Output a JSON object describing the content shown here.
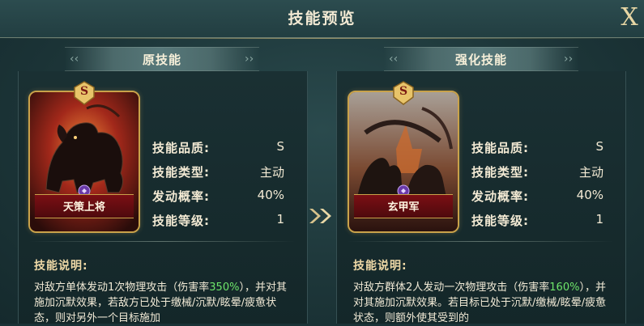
{
  "header": {
    "title": "技能预览",
    "close_label": "X"
  },
  "sections": {
    "original": {
      "ribbon": "原技能"
    },
    "enhanced": {
      "ribbon": "强化技能"
    }
  },
  "cards": {
    "original": {
      "rank": "S",
      "name": "天策上将"
    },
    "enhanced": {
      "rank": "S",
      "name": "玄甲军"
    }
  },
  "stats_labels": {
    "quality": "技能品质:",
    "type": "技能类型:",
    "chance": "发动概率:",
    "level": "技能等级:"
  },
  "original_stats": {
    "quality": "S",
    "type": "主动",
    "chance": "40%",
    "level": "1"
  },
  "enhanced_stats": {
    "quality": "S",
    "type": "主动",
    "chance": "40%",
    "level": "1"
  },
  "description_title": "技能说明:",
  "original_desc": {
    "pre": "对敌方单体发动1次物理攻击（伤害率",
    "highlight": "350%",
    "post": "），并对其施加沉默效果，若敌方已处于缴械/沉默/眩晕/疲惫状态，则对另外一个目标施加"
  },
  "enhanced_desc": {
    "pre": "对敌方群体2人发动一次物理攻击（伤害率",
    "highlight": "160%",
    "post": "），并对其施加沉默效果。若目标已处于沉默/缴械/眩晕/疲惫状态，则额外使其受到的"
  },
  "colors": {
    "accent_gold": "#c9a24a",
    "highlight_green": "#6ee56a",
    "bg": "#1d3639"
  },
  "icons": [
    "close-icon",
    "double-chevron-right-icon",
    "rank-badge-icon",
    "purple-gem-icon"
  ]
}
